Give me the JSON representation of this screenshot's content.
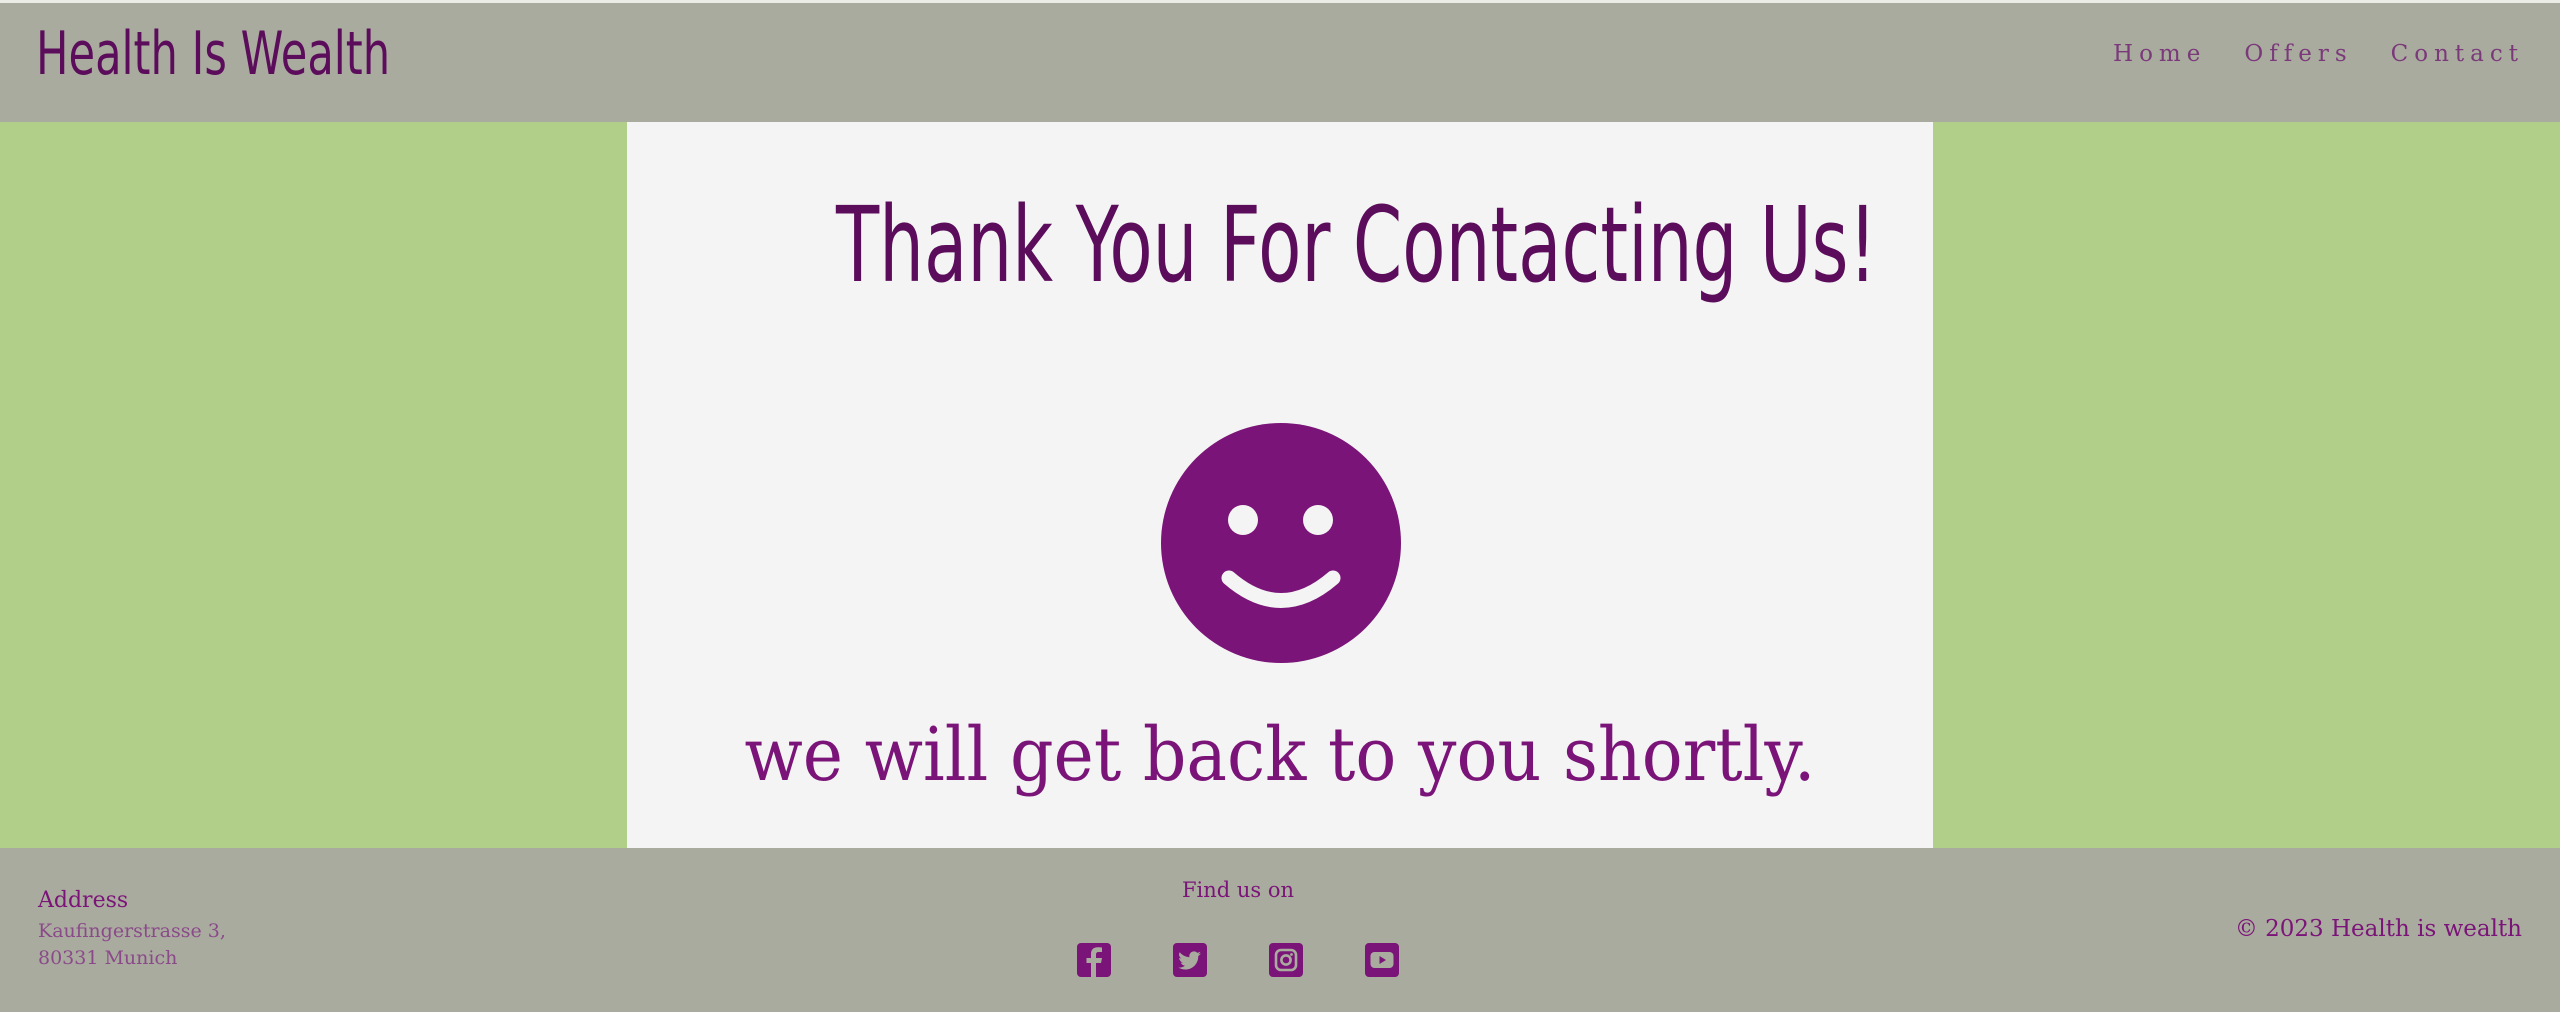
{
  "header": {
    "brand": "Health Is Wealth",
    "nav": [
      {
        "label": "Home"
      },
      {
        "label": "Offers"
      },
      {
        "label": "Contact"
      }
    ]
  },
  "main": {
    "heading": "Thank You For Contacting Us!",
    "icon": "smiley-face-icon",
    "subheading": "we will get back to you shortly."
  },
  "footer": {
    "address_title": "Address",
    "address_lines": [
      "Kaufingerstrasse 3,",
      "80331 Munich"
    ],
    "find_us": "Find us on",
    "social_icons": [
      "facebook-icon",
      "twitter-icon",
      "instagram-icon",
      "youtube-icon"
    ],
    "copyright": "© 2023 Health is wealth"
  },
  "colors": {
    "header_bg": "#aaab9f",
    "page_bg": "#b1cf89",
    "card_bg": "#f4f4f4",
    "accent": "#7b1478",
    "dark_purple": "#5b0d5b"
  }
}
